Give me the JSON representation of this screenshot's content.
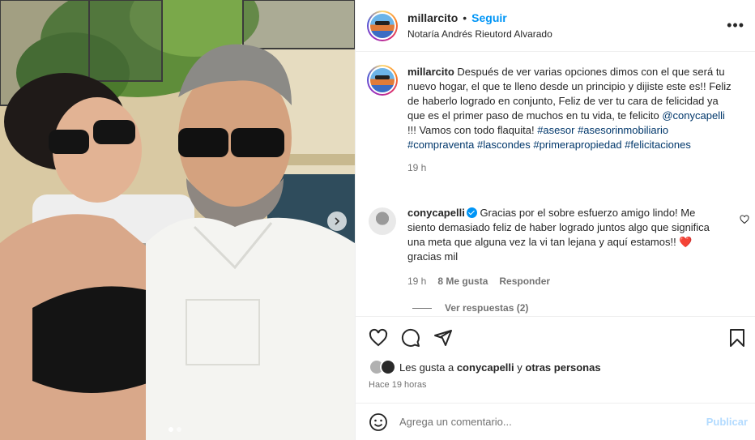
{
  "post": {
    "username": "millarcito",
    "separator": "•",
    "follow_label": "Seguir",
    "location": "Notaría Andrés Rieutord Alvarado",
    "more_label": "•••"
  },
  "caption": {
    "username": "millarcito",
    "text_before_mention": "Después de ver varias opciones dimos con el que será tu nuevo hogar, el que te lleno desde un principio y dijiste este es!! Feliz de haberlo logrado en conjunto, Feliz de ver tu cara de felicidad ya que es el primer paso de muchos en tu vida, te felicito ",
    "mention": "@conycapelli",
    "text_after_mention": " !!! Vamos con todo flaquita! ",
    "hashtags": [
      "#asesor",
      "#asesorinmobiliario",
      "#compraventa",
      "#lascondes",
      "#primerapropiedad",
      "#felicitaciones"
    ],
    "time": "19 h"
  },
  "comment": {
    "username": "conycapelli",
    "text": "Gracias por el sobre esfuerzo amigo lindo! Me siento demasiado feliz de haber logrado juntos algo que significa una meta que alguna vez la vi tan lejana y aquí estamos!! ",
    "emoji": "❤️",
    "text_end": " gracias mil",
    "time": "19 h",
    "likes": "8 Me gusta",
    "reply_label": "Responder",
    "view_replies": "Ver respuestas (2)"
  },
  "likes_line": {
    "prefix": "Les gusta a ",
    "user": "conycapelli",
    "middle": " y ",
    "others": "otras personas"
  },
  "timestamp": "Hace 19 horas",
  "composer": {
    "placeholder": "Agrega un comentario...",
    "publish_label": "Publicar"
  },
  "colors": {
    "link_blue": "#0095f6",
    "hashtag": "#00376b",
    "secondary_text": "#737373",
    "publish_disabled": "#b3dbff"
  },
  "icons": [
    "more-icon",
    "heart-icon",
    "comment-icon",
    "share-icon",
    "bookmark-icon",
    "emoji-icon",
    "chevron-right-icon",
    "verified-icon"
  ]
}
